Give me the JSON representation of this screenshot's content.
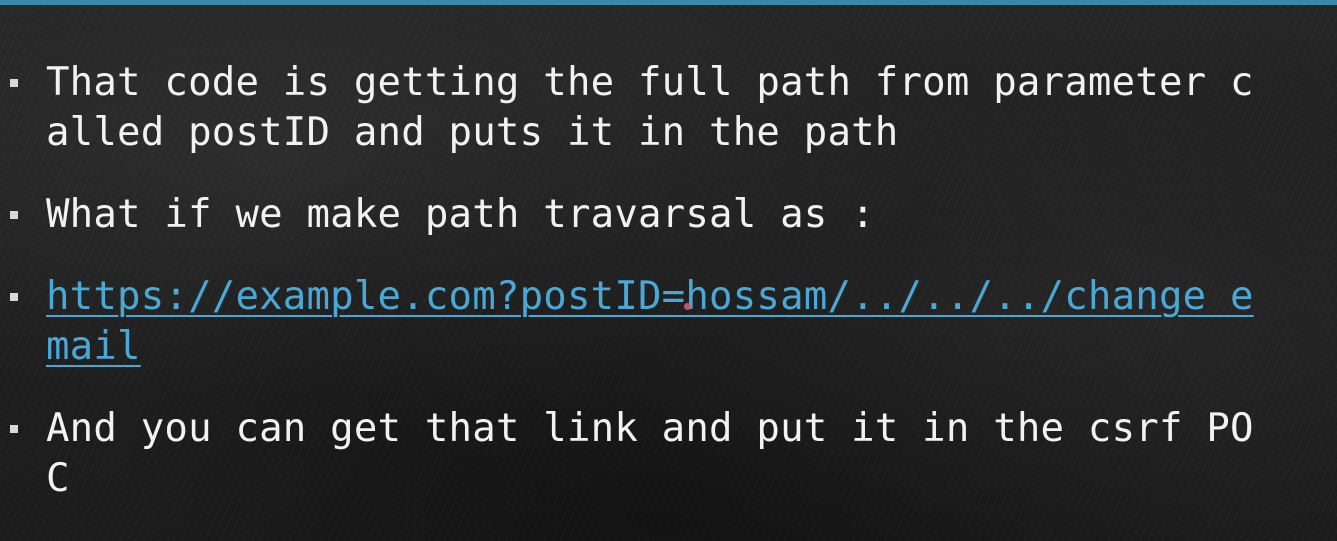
{
  "slide": {
    "accent_color": "#3a9ac4",
    "link_color": "#49a9d6",
    "text_color": "#f2f2f2",
    "bullet_icon": "square-bullet-icon",
    "bullets": [
      {
        "text": "That code is getting the full path from parameter called postID and puts it in the path"
      },
      {
        "text": "What if we make path travarsal as :"
      },
      {
        "link": "https://example.com?postID=hossam/../../../change email"
      },
      {
        "text": "And you can get that link and put it in the csrf POC"
      }
    ]
  }
}
